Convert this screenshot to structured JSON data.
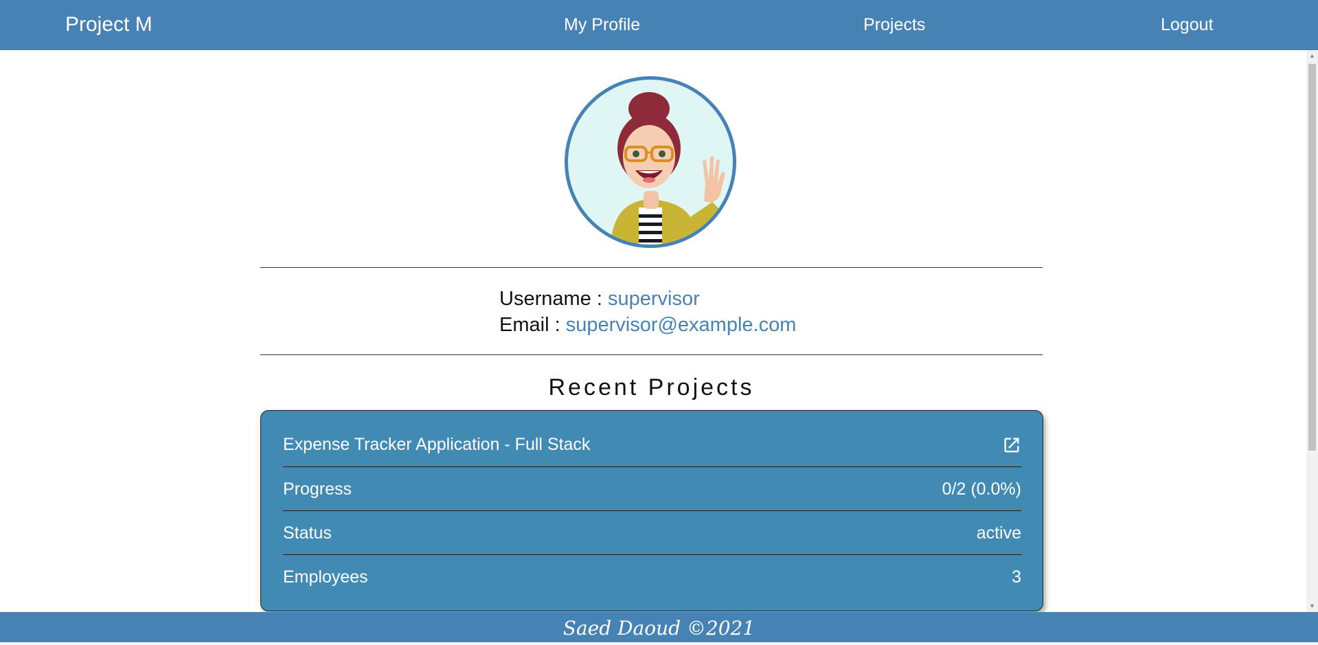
{
  "navbar": {
    "brand": "Project M",
    "links": {
      "profile": "My Profile",
      "projects": "Projects",
      "logout": "Logout"
    }
  },
  "profile": {
    "avatar_icon": "avatar-cartoon-woman-waving",
    "username_label": "Username :",
    "username": "supervisor",
    "email_label": "Email :",
    "email": "supervisor@example.com"
  },
  "recent_projects": {
    "title": "Recent Projects",
    "project": {
      "name": "Expense Tracker Application - Full Stack",
      "open_icon": "external-link-icon",
      "progress_label": "Progress",
      "progress_value": "0/2 (0.0%)",
      "status_label": "Status",
      "status_value": "active",
      "employees_label": "Employees",
      "employees_value": "3"
    }
  },
  "footer": {
    "text": "Saed Daoud ©2021"
  },
  "colors": {
    "primary": "#4682b4",
    "card": "#418ab3"
  }
}
